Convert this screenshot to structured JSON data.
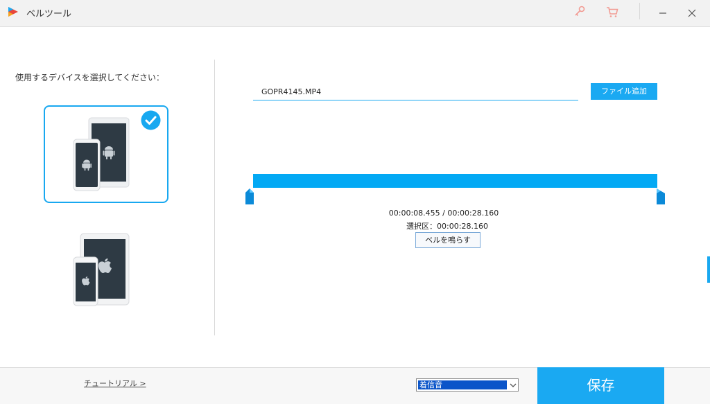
{
  "window": {
    "title": "ベルツール",
    "icons": [
      "app-logo-icon",
      "key-icon",
      "cart-icon",
      "minimize-icon",
      "close-icon"
    ]
  },
  "left_panel": {
    "prompt": "使用するデバイスを選択してください：",
    "devices": [
      {
        "name": "android",
        "selected": true,
        "icon": "android-devices-icon"
      },
      {
        "name": "apple",
        "selected": false,
        "icon": "apple-devices-icon"
      }
    ]
  },
  "right_panel": {
    "file_name": "GOPR4145.MP4",
    "add_file_label": "ファイル追加",
    "time_readout": "00:00:08.455 / 00:00:28.160",
    "selection_readout": "選択区：00:00:28.160",
    "ring_button_label": "ベルを鳴らす"
  },
  "bottom": {
    "tutorial_link": "チュートリアル >",
    "ringtone_selected": "着信音",
    "save_label": "保存"
  },
  "colors": {
    "accent": "#1aa9f2",
    "timeline": "#03a9f4",
    "select_highlight": "#0b55c9"
  }
}
